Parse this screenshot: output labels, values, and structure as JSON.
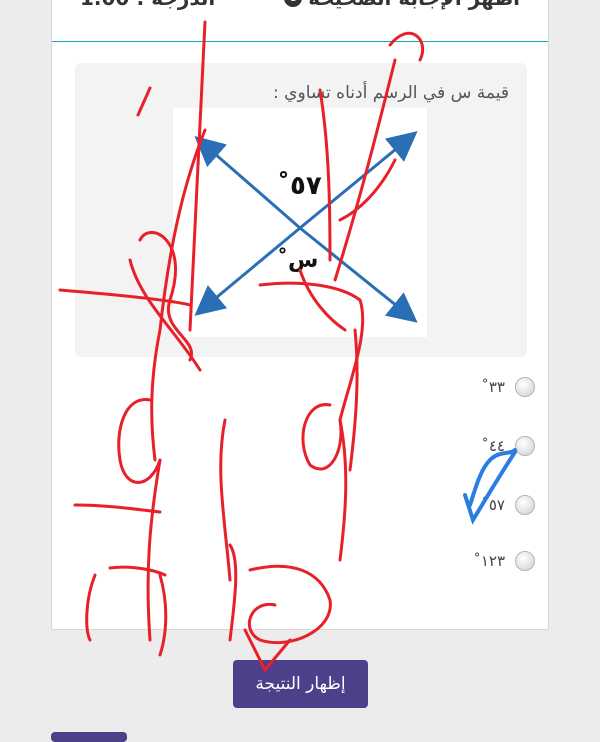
{
  "header": {
    "title": "أظهر الإجابة الصحيحة",
    "grade": "الدرجة : 1.00"
  },
  "question": {
    "text": "قيمة  س  في الرسم أدناه تساوي :",
    "angle_top": "٥٧˚",
    "angle_bottom": "س˚"
  },
  "options": [
    {
      "label": "٣٣˚",
      "selected": false
    },
    {
      "label": "٤٤˚",
      "selected": false
    },
    {
      "label": "٥٧˚",
      "selected": false
    },
    {
      "label": "١٢٣˚",
      "selected": false
    }
  ],
  "actions": {
    "show_result_label": "إظهار النتيجة"
  },
  "colors": {
    "accent": "#4d3f8a",
    "header_rule": "#19a7b7",
    "arrow": "#2a6fb5",
    "annotation_red": "#e8202a",
    "annotation_blue": "#2a7de1"
  }
}
